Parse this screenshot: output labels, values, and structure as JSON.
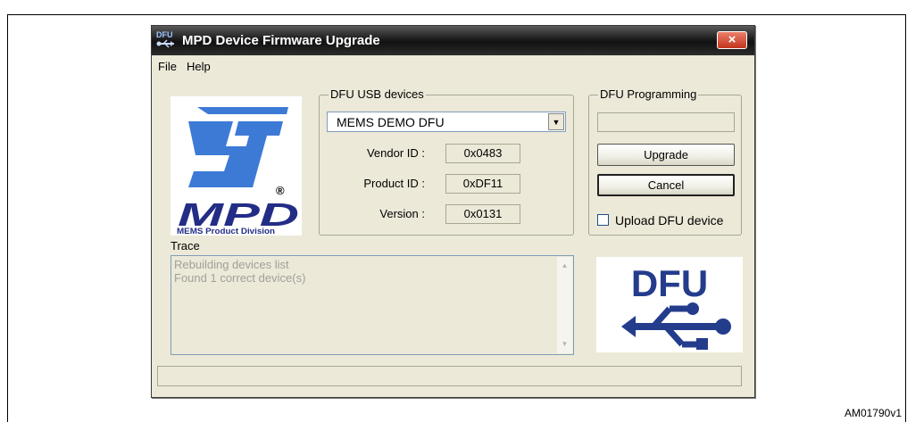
{
  "window": {
    "icon_label": "DFU",
    "title": "MPD Device Firmware Upgrade",
    "close_label": "×"
  },
  "menu": {
    "items": [
      {
        "label": "File"
      },
      {
        "label": "Help"
      }
    ]
  },
  "logo": {
    "brand_text": "MPD",
    "caption": "MEMS Product Division",
    "registered_mark": "®",
    "brand_color": "#3c7ad6",
    "accent_color": "#232d86"
  },
  "usb_devices": {
    "legend": "DFU USB devices",
    "selected_device": "MEMS DEMO DFU",
    "fields": [
      {
        "label": "Vendor ID :",
        "value": "0x0483"
      },
      {
        "label": "Product ID :",
        "value": "0xDF11"
      },
      {
        "label": "Version :",
        "value": "0x0131"
      }
    ]
  },
  "programming": {
    "legend": "DFU Programming",
    "progress_fraction": 0,
    "upgrade_label": "Upgrade",
    "cancel_label": "Cancel",
    "upload_checkbox_label": "Upload DFU device",
    "upload_checked": false
  },
  "trace": {
    "label": "Trace",
    "lines": [
      "Rebuilding devices list",
      "Found 1 correct device(s)"
    ]
  },
  "dfu_logo": {
    "text": "DFU",
    "color": "#243c8c"
  },
  "status": {
    "progress_fraction": 0
  },
  "figure": {
    "id": "AM01790v1"
  }
}
